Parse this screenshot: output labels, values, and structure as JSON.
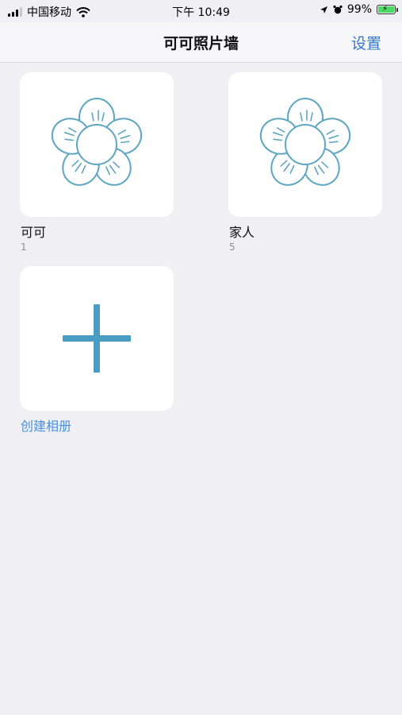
{
  "status_bar": {
    "carrier": "中国移动",
    "time": "下午 10:49",
    "battery": "99%"
  },
  "nav": {
    "title": "可可照片墙",
    "settings": "设置"
  },
  "albums": [
    {
      "name": "可可",
      "count": "1"
    },
    {
      "name": "家人",
      "count": "5"
    }
  ],
  "create": {
    "label": "创建相册"
  },
  "colors": {
    "accent": "#3478c5",
    "icon": "#5ea6c2",
    "plus": "#4a9cc2"
  }
}
